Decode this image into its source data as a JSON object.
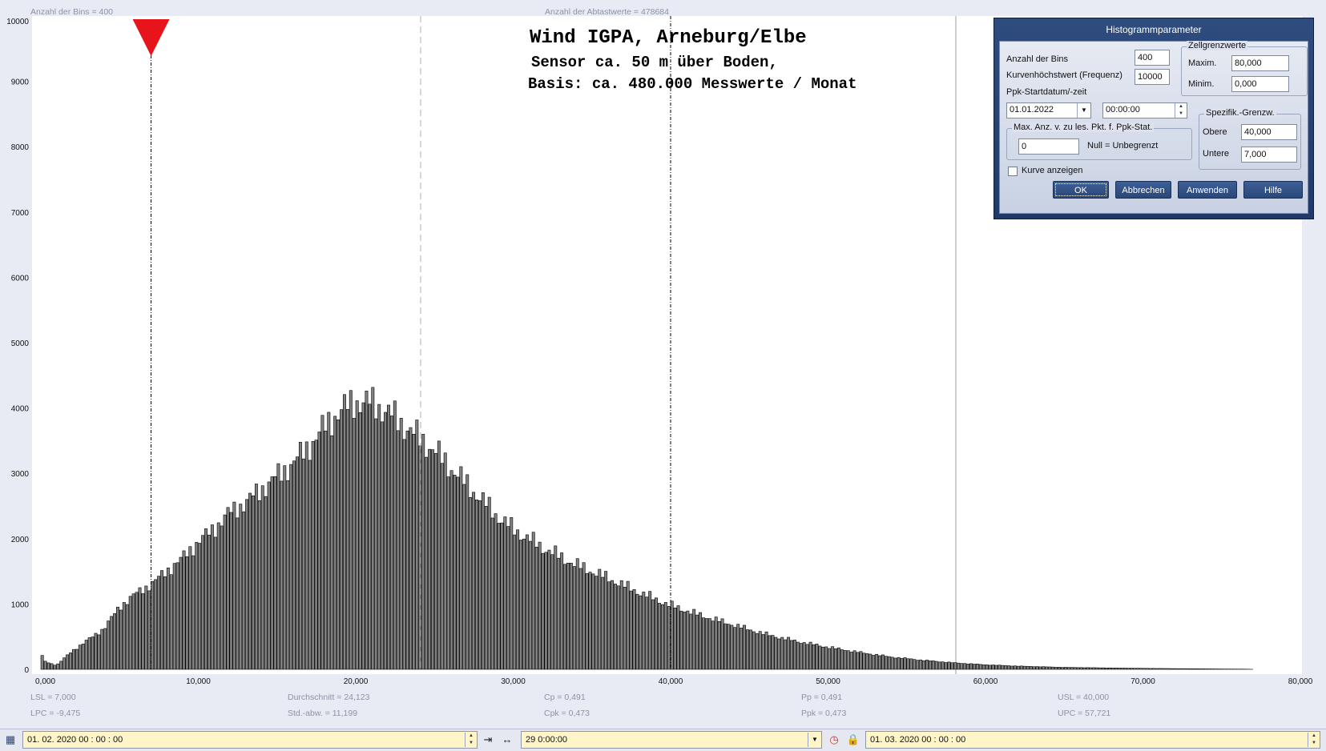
{
  "header": {
    "bins_info": "Anzahl der Bins =   400",
    "samples_info": "Anzahl der Abtastwerte = 478684"
  },
  "title": {
    "line1": "Wind  IGPA, Arneburg/Elbe",
    "line2": "Sensor ca. 50 m über Boden,",
    "line3": "Basis: ca. 480.000 Messwerte / Monat"
  },
  "stats": {
    "lsl": "LSL = 7,000",
    "lpc": "LPC = -9,475",
    "mean": "Durchschnitt  = 24,123",
    "std": "Std.-abw.  = 11,199",
    "cp": "Cp  = 0,491",
    "cpk": "Cpk = 0,473",
    "pp": "Pp  = 0,491",
    "ppk": "Ppk = 0,473",
    "usl": "USL = 40,000",
    "upc": "UPC = 57,721"
  },
  "dialog": {
    "title": "Histogrammparameter",
    "bins_label": "Anzahl der Bins",
    "bins_value": "400",
    "maxfreq_label": "Kurvenhöchstwert (Frequenz)",
    "maxfreq_value": "10000",
    "start_label": "Ppk-Startdatum/-zeit",
    "start_date": "01.01.2022",
    "start_time": "00:00:00",
    "cell_group": "Zellgrenzwerte",
    "max_label": "Maxim.",
    "max_value": "80,000",
    "min_label": "Minim.",
    "min_value": "0,000",
    "maxpts_group": "Max. Anz. v. zu les. Pkt. f. Ppk-Stat.",
    "maxpts_value": "0",
    "maxpts_hint": "Null = Unbegrenzt",
    "spec_group": "Spezifik.-Grenzw.",
    "upper_label": "Obere",
    "upper_value": "40,000",
    "lower_label": "Untere",
    "lower_value": "7,000",
    "curve_label": "Kurve anzeigen",
    "ok": "OK",
    "cancel": "Abbrechen",
    "apply": "Anwenden",
    "help": "Hilfe"
  },
  "bottom": {
    "start": "01. 02. 2020    00 : 00 : 00",
    "duration": "29  0:00:00",
    "end": "01. 03. 2020    00 : 00 : 00",
    "icons": [
      "calendar-icon",
      "collapse-arrows-icon",
      "expand-arrows-icon",
      "clock-icon",
      "lock-icon"
    ]
  },
  "colors": {
    "bar": "#808080",
    "marker": "#e8141c",
    "accent": "#2a4778",
    "field": "#fff5c8"
  },
  "chart_data": {
    "type": "bar",
    "title": "Wind  IGPA, Arneburg/Elbe",
    "xlim": [
      0,
      80
    ],
    "ylim": [
      0,
      10000
    ],
    "bin_width": 0.2,
    "ytick_labels": [
      "0",
      "1000",
      "2000",
      "3000",
      "4000",
      "5000",
      "6000",
      "7000",
      "8000",
      "9000",
      "10000"
    ],
    "xtick_labels": [
      "0,000",
      "10,000",
      "20,000",
      "30,000",
      "40,000",
      "50,000",
      "60,000",
      "70,000",
      "80,000"
    ],
    "lsl": 7.0,
    "usl": 40.0,
    "mean": 24.123,
    "upc": 57.721,
    "profile": [
      [
        0,
        250
      ],
      [
        0.3,
        120
      ],
      [
        1,
        60
      ],
      [
        2,
        280
      ],
      [
        3,
        450
      ],
      [
        4,
        620
      ],
      [
        5,
        950
      ],
      [
        6,
        1150
      ],
      [
        7,
        1300
      ],
      [
        8,
        1500
      ],
      [
        9,
        1700
      ],
      [
        10,
        1950
      ],
      [
        11,
        2150
      ],
      [
        12,
        2400
      ],
      [
        13,
        2550
      ],
      [
        14,
        2750
      ],
      [
        15,
        2950
      ],
      [
        16,
        3150
      ],
      [
        17,
        3400
      ],
      [
        18,
        3700
      ],
      [
        19,
        3950
      ],
      [
        20,
        4100
      ],
      [
        21,
        4080
      ],
      [
        22,
        3950
      ],
      [
        23,
        3750
      ],
      [
        24,
        3550
      ],
      [
        25,
        3350
      ],
      [
        26,
        3100
      ],
      [
        27,
        2850
      ],
      [
        28,
        2600
      ],
      [
        29,
        2350
      ],
      [
        30,
        2150
      ],
      [
        32,
        1850
      ],
      [
        34,
        1600
      ],
      [
        36,
        1400
      ],
      [
        38,
        1180
      ],
      [
        40,
        980
      ],
      [
        42,
        820
      ],
      [
        44,
        680
      ],
      [
        46,
        540
      ],
      [
        48,
        430
      ],
      [
        50,
        340
      ],
      [
        52,
        260
      ],
      [
        54,
        190
      ],
      [
        56,
        140
      ],
      [
        58,
        100
      ],
      [
        60,
        70
      ],
      [
        62,
        50
      ],
      [
        65,
        30
      ],
      [
        70,
        15
      ],
      [
        75,
        5
      ],
      [
        76.6,
        3
      ],
      [
        77,
        0
      ],
      [
        80,
        0
      ]
    ]
  }
}
